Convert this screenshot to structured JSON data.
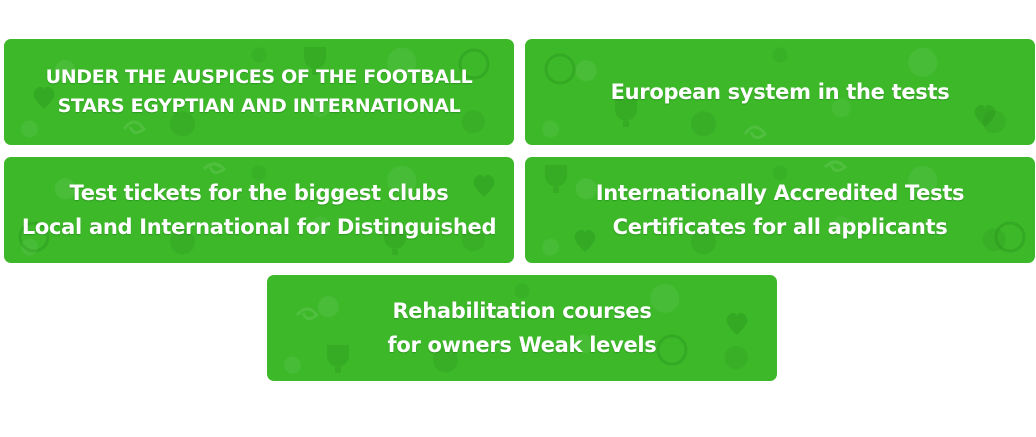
{
  "colors": {
    "card_background": "#3cb829",
    "card_text": "#ffffff",
    "page_background": "#ffffff"
  },
  "pattern_icons": [
    "heart-icon",
    "trophy-icon",
    "football-icon",
    "swirl-icon"
  ],
  "cards": [
    {
      "lines": [
        "UNDER THE AUSPICES OF THE FOOTBALL",
        "STARS EGYPTIAN AND INTERNATIONAL"
      ]
    },
    {
      "lines": [
        "European system in the tests"
      ]
    },
    {
      "lines": [
        "Test tickets for the biggest clubs",
        "Local and International for Distinguished"
      ]
    },
    {
      "lines": [
        "Internationally Accredited Tests",
        "Certificates for all applicants"
      ]
    },
    {
      "lines": [
        "Rehabilitation courses",
        "for owners Weak levels"
      ]
    }
  ]
}
